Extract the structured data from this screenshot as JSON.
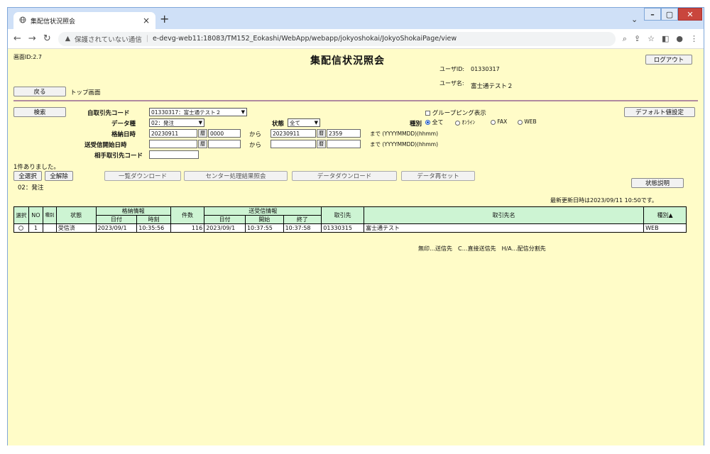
{
  "browser": {
    "tab_title": "集配信状況照会",
    "tab_close": "×",
    "new_tab": "+",
    "security_label": "保護されていない通信",
    "url": "e-devg-web11:18083/TM152_Eokashi/WebApp/webapp/jokyoshokai/JokyoShokaiPage/view"
  },
  "page": {
    "screen_id": "画面ID:2.7",
    "title": "集配信状況照会",
    "logout_button": "ログアウト",
    "user_id_label": "ユーザID:",
    "user_id_value": "01330317",
    "user_name_label": "ユーザ名:",
    "user_name_value": "富士通テスト２",
    "back_button": "戻る",
    "top_screen_label": "トップ画面"
  },
  "search": {
    "search_button": "検索",
    "self_partner_code_label": "自取引先コード",
    "self_partner_code_value": "01330317：富士通テスト２",
    "data_type_label": "データ種",
    "data_type_value": "02：発注",
    "status_label": "状態",
    "status_value": "全て",
    "grouping_label": "グループピング表示",
    "kind_label": "種別",
    "kind_options": [
      "全て",
      "ｵﾝﾗｲﾝ",
      "FAX",
      "WEB"
    ],
    "default_button": "デフォルト値設定",
    "storage_datetime_label": "格納日時",
    "storage_from_date": "20230911",
    "storage_from_time": "0000",
    "from_label": "から",
    "storage_to_date": "20230911",
    "storage_to_time": "2359",
    "until_format": "まで (YYYYMMDD)(hhmm)",
    "calendar_label": "暦",
    "send_start_label": "送受信開始日時",
    "send_from_label": "から",
    "send_until_format": "まで (YYYYMMDD)(hhmm)",
    "partner_code_label": "相手取引先コード"
  },
  "results": {
    "count_text": "1件ありました。",
    "select_all": "全選択",
    "deselect_all": "全解除",
    "list_download": "一覧ダウンロード",
    "center_result": "センター処理結果照会",
    "data_download": "データダウンロード",
    "data_reset": "データ再セット",
    "status_desc": "状態説明",
    "filter_label": "02：発注",
    "last_updated": "最新更新日時は2023/09/11 10:50です。"
  },
  "table": {
    "headers": {
      "select": "選択",
      "no": "NO",
      "kind_mark": "種別",
      "status": "状態",
      "storage_info": "格納情報",
      "date": "日付",
      "time": "時刻",
      "count": "件数",
      "send_info": "送受信情報",
      "send_date": "日付",
      "start": "開始",
      "end": "終了",
      "partner": "取引先",
      "partner_name": "取引先名",
      "type": "種別▲"
    },
    "rows": [
      {
        "no": "1",
        "mark": "",
        "status": "受信済",
        "date": "2023/09/1",
        "time": "10:35:56",
        "count": "116",
        "send_date": "2023/09/1",
        "start": "10:37:55",
        "end": "10:37:58",
        "partner": "01330315",
        "partner_name": "富士通テスト",
        "type": "WEB"
      }
    ],
    "legend": "無印…送信先　C…直接送信先　H/A…配信分割先"
  },
  "colors": {
    "page_bg": "#fffcc8",
    "header_bg": "#cdf4d3",
    "divider": "#b08aa0",
    "chrome_frame": "#cfe0f7"
  }
}
